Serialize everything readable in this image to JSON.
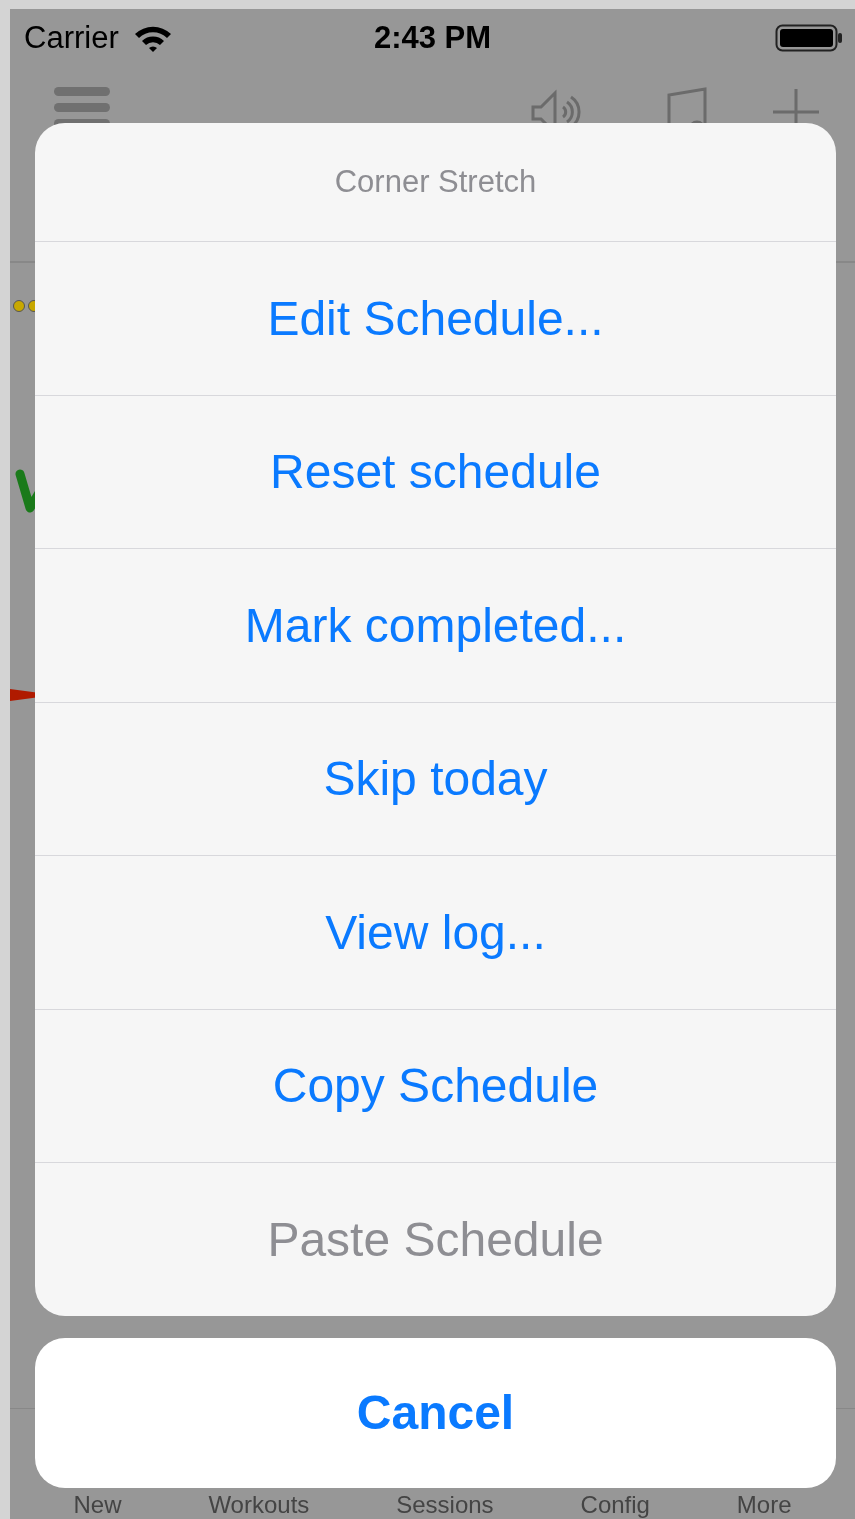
{
  "status_bar": {
    "carrier": "Carrier",
    "time": "2:43 PM"
  },
  "tab_bar": {
    "items": [
      {
        "label": "New"
      },
      {
        "label": "Workouts"
      },
      {
        "label": "Sessions"
      },
      {
        "label": "Config"
      },
      {
        "label": "More"
      }
    ]
  },
  "action_sheet": {
    "title": "Corner Stretch",
    "actions": [
      {
        "label": "Edit Schedule...",
        "disabled": false
      },
      {
        "label": "Reset schedule",
        "disabled": false
      },
      {
        "label": "Mark completed...",
        "disabled": false
      },
      {
        "label": "Skip today",
        "disabled": false
      },
      {
        "label": "View log...",
        "disabled": false
      },
      {
        "label": "Copy Schedule",
        "disabled": false
      },
      {
        "label": "Paste Schedule",
        "disabled": true
      }
    ],
    "cancel": "Cancel"
  }
}
